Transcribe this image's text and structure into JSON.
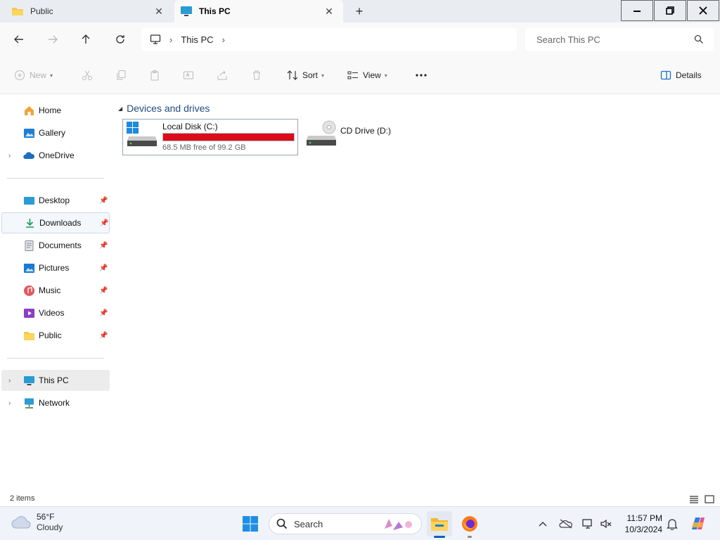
{
  "tabs": [
    {
      "label": "Public",
      "icon": "folder-icon",
      "active": false
    },
    {
      "label": "This PC",
      "icon": "monitor-icon",
      "active": true
    }
  ],
  "window_controls": {
    "minimize": "minimize-icon",
    "maximize": "restore-icon",
    "close": "close-icon"
  },
  "address": {
    "breadcrumb": [
      "This PC"
    ],
    "search_placeholder": "Search This PC"
  },
  "commands": {
    "new_label": "New",
    "sort_label": "Sort",
    "view_label": "View",
    "details_label": "Details"
  },
  "nav": {
    "top": [
      {
        "label": "Home",
        "icon": "home-icon"
      },
      {
        "label": "Gallery",
        "icon": "gallery-icon"
      },
      {
        "label": "OneDrive",
        "icon": "onedrive-icon"
      }
    ],
    "quick": [
      {
        "label": "Desktop",
        "icon": "desktop-icon"
      },
      {
        "label": "Downloads",
        "icon": "downloads-icon"
      },
      {
        "label": "Documents",
        "icon": "documents-icon"
      },
      {
        "label": "Pictures",
        "icon": "pictures-icon"
      },
      {
        "label": "Music",
        "icon": "music-icon"
      },
      {
        "label": "Videos",
        "icon": "videos-icon"
      },
      {
        "label": "Public",
        "icon": "folder-icon"
      }
    ],
    "bottom": [
      {
        "label": "This PC",
        "icon": "monitor-icon"
      },
      {
        "label": "Network",
        "icon": "network-icon"
      }
    ]
  },
  "content": {
    "group_title": "Devices and drives",
    "drives": [
      {
        "name": "Local Disk (C:)",
        "free_text": "68.5 MB free of 99.2 GB",
        "used_fraction": 0.9993
      },
      {
        "name": "CD Drive (D:)"
      }
    ]
  },
  "status": {
    "item_count": "2 items"
  },
  "taskbar": {
    "weather_temp": "56°F",
    "weather_cond": "Cloudy",
    "search_label": "Search",
    "time": "11:57 PM",
    "date": "10/3/2024"
  },
  "colors": {
    "accent": "#005fb8",
    "drive_full": "#da0b1b"
  }
}
